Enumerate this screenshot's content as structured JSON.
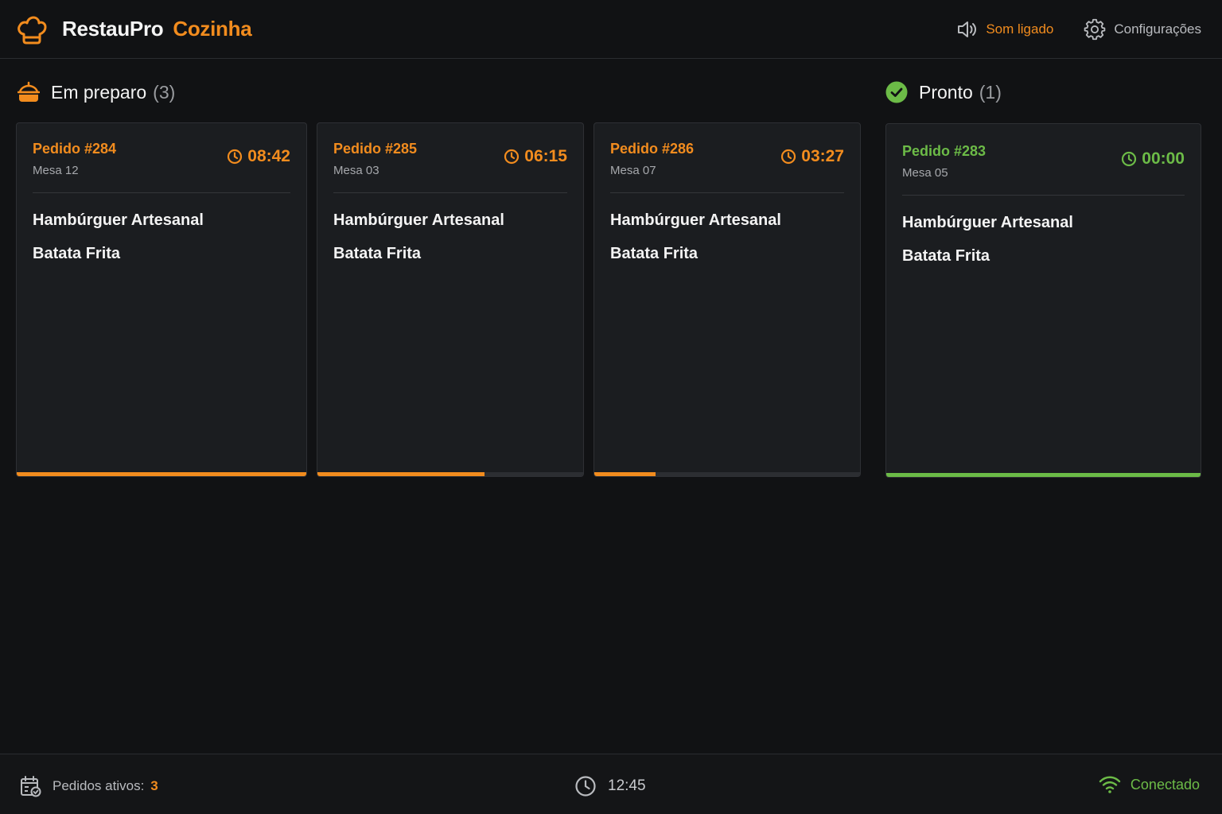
{
  "header": {
    "brand_name": "RestauPro",
    "brand_sub": "Cozinha",
    "sound_label": "Som ligado",
    "settings_label": "Configurações"
  },
  "sections": {
    "preparing": {
      "title": "Em preparo",
      "count": "(3)"
    },
    "ready": {
      "title": "Pronto",
      "count": "(1)"
    }
  },
  "orders": [
    {
      "order": "Pedido #284",
      "table": "Mesa 12",
      "timer": "08:42",
      "items": [
        "Hambúrguer Artesanal",
        "Batata Frita"
      ],
      "progress": 1.0,
      "status": "preparing"
    },
    {
      "order": "Pedido #285",
      "table": "Mesa 03",
      "timer": "06:15",
      "items": [
        "Hambúrguer Artesanal",
        "Batata Frita"
      ],
      "progress": 0.63,
      "status": "preparing"
    },
    {
      "order": "Pedido #286",
      "table": "Mesa 07",
      "timer": "03:27",
      "items": [
        "Hambúrguer Artesanal",
        "Batata Frita"
      ],
      "progress": 0.23,
      "status": "preparing"
    },
    {
      "order": "Pedido #283",
      "table": "Mesa 05",
      "timer": "00:00",
      "items": [
        "Hambúrguer Artesanal",
        "Batata Frita"
      ],
      "progress": 1.0,
      "status": "ready"
    }
  ],
  "footer": {
    "active_label": "Pedidos ativos:",
    "active_count": "3",
    "clock": "12:45",
    "connection": "Conectado"
  },
  "colors": {
    "accent": "#f28c1e",
    "ready": "#6cbb47",
    "background": "#111214",
    "card": "#1b1d20"
  },
  "icons": {
    "logo": "chef-hat-icon",
    "sound": "speaker-icon",
    "settings": "gear-icon",
    "preparing": "cooking-pot-icon",
    "ready": "check-circle-icon",
    "timer": "clock-icon",
    "active_orders": "calendar-check-icon",
    "clock": "clock-icon",
    "connection": "wifi-icon"
  }
}
